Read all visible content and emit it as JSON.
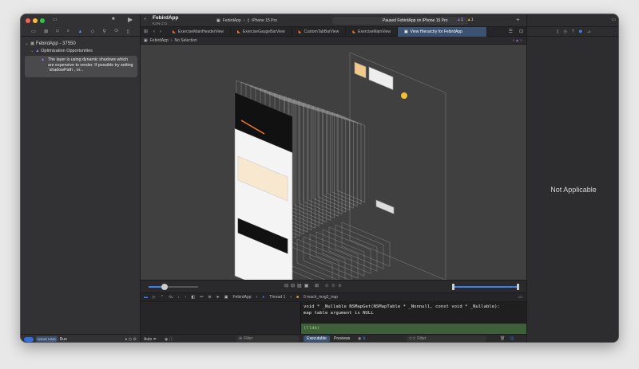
{
  "toolbar": {
    "project": "FebirdApp",
    "branch": "KAN-171",
    "scheme": "FebirdApp",
    "device": "iPhone 15 Pro",
    "status": "Paused FebirdApp on iPhone 15 Pro",
    "purple_warnings": "1",
    "yellow_warnings": "1"
  },
  "tabs": [
    {
      "label": "ExerciseMainHeaderView"
    },
    {
      "label": "ExerciseGaugeBarView"
    },
    {
      "label": "CustomTabBarView"
    },
    {
      "label": "ExerciseMainView"
    },
    {
      "label": "View Hierarchy for FebirdApp",
      "selected": true
    }
  ],
  "jumpbar": {
    "root": "FebirdApp",
    "selection": "No Selection"
  },
  "navigator": {
    "process": "FebirdApp - 37550",
    "group": "Optimization Opportunities",
    "issue": "The layer is using dynamic shadows which are expensive to render. If possible try setting `shadowPath`, or...",
    "filter_tag": "ISSUE KIND",
    "filter_value": "Run"
  },
  "inspector": {
    "empty": "Not Applicable"
  },
  "debug": {
    "breadcrumb": [
      "FebirdApp",
      "Thread 1",
      "0 mach_msg2_trap"
    ],
    "console_lines": [
      "void * _Nullable NSMapGet(NSMapTable * _Nonnull, const void * _Nullable):",
      "map table argument is NULL"
    ],
    "prompt": "(lldb)",
    "vars_scope": "Auto ≑",
    "filter_placeholder": "Filter",
    "output_tabs": [
      "Executable",
      "Previews"
    ]
  },
  "colors": {
    "accent": "#3b5272",
    "warning_purple": "#a56bf0",
    "prompt_bg": "#3f5f3a"
  }
}
